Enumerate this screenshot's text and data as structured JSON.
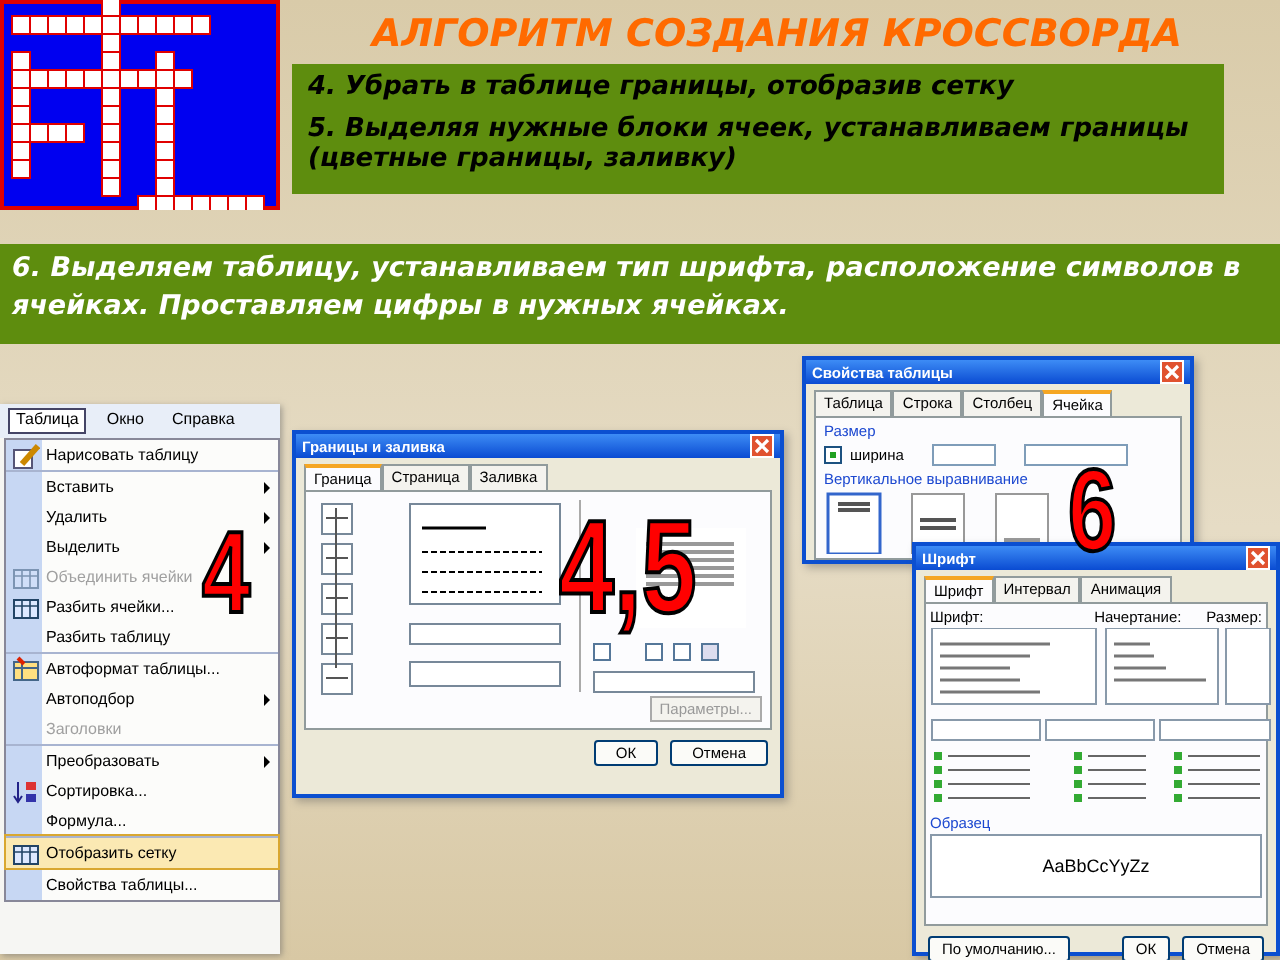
{
  "title": "АЛГОРИТМ СОЗДАНИЯ КРОССВОРДА",
  "steps_box": {
    "steps": [
      "4. Убрать в таблице границы, отобразив сетку",
      "5. Выделяя нужные блоки ячеек, устанавливаем границы (цветные границы, заливку)"
    ]
  },
  "step_banner": {
    "text": "6. Выделяем таблицу, устанавливаем тип шрифта, расположение символов в ячейках. Проставляем цифры в нужных ячейках."
  },
  "table_menu": {
    "badge": "4",
    "menubar": [
      {
        "label": "Таблица",
        "selected": true
      },
      {
        "label": "Окно",
        "selected": false
      },
      {
        "label": "Справка",
        "selected": false
      }
    ],
    "items": [
      {
        "label": "Нарисовать таблицу",
        "kind": "pencil",
        "submenu": false,
        "disabled": false,
        "selected": false,
        "divider_above": false
      },
      {
        "label": "Вставить",
        "kind": "plain",
        "submenu": true,
        "disabled": false,
        "selected": false,
        "divider_above": true
      },
      {
        "label": "Удалить",
        "kind": "plain",
        "submenu": true,
        "disabled": false,
        "selected": false,
        "divider_above": false
      },
      {
        "label": "Выделить",
        "kind": "plain",
        "submenu": true,
        "disabled": false,
        "selected": false,
        "divider_above": false
      },
      {
        "label": "Объединить ячейки",
        "kind": "merge",
        "submenu": false,
        "disabled": true,
        "selected": false,
        "divider_above": false
      },
      {
        "label": "Разбить ячейки...",
        "kind": "split",
        "submenu": false,
        "disabled": false,
        "selected": false,
        "divider_above": false
      },
      {
        "label": "Разбить таблицу",
        "kind": "plain",
        "submenu": false,
        "disabled": false,
        "selected": false,
        "divider_above": false
      },
      {
        "label": "Автоформат таблицы...",
        "kind": "autoformat",
        "submenu": false,
        "disabled": false,
        "selected": false,
        "divider_above": true
      },
      {
        "label": "Автоподбор",
        "kind": "plain",
        "submenu": true,
        "disabled": false,
        "selected": false,
        "divider_above": false
      },
      {
        "label": "Заголовки",
        "kind": "plain",
        "submenu": false,
        "disabled": true,
        "selected": false,
        "divider_above": false
      },
      {
        "label": "Преобразовать",
        "kind": "plain",
        "submenu": true,
        "disabled": false,
        "selected": false,
        "divider_above": true
      },
      {
        "label": "Сортировка...",
        "kind": "sort",
        "submenu": false,
        "disabled": false,
        "selected": false,
        "divider_above": false
      },
      {
        "label": "Формула...",
        "kind": "plain",
        "submenu": false,
        "disabled": false,
        "selected": false,
        "divider_above": false
      },
      {
        "label": "Отобразить сетку",
        "kind": "grid",
        "submenu": false,
        "disabled": false,
        "selected": true,
        "divider_above": true
      },
      {
        "label": "Свойства таблицы...",
        "kind": "plain",
        "submenu": false,
        "disabled": false,
        "selected": false,
        "divider_above": true
      }
    ]
  },
  "borders_dialog": {
    "title": "Границы и заливка",
    "badge": "4,5",
    "tabs": [
      {
        "label": "Граница",
        "selected": true
      },
      {
        "label": "Страница",
        "selected": false
      },
      {
        "label": "Заливка",
        "selected": false
      }
    ],
    "options_button": "Параметры...",
    "buttons": [
      "ОК",
      "Отмена"
    ]
  },
  "table_props_dialog": {
    "title": "Свойства таблицы",
    "badge": "6",
    "tabs": [
      {
        "label": "Таблица",
        "selected": false
      },
      {
        "label": "Строка",
        "selected": false
      },
      {
        "label": "Столбец",
        "selected": false
      },
      {
        "label": "Ячейка",
        "selected": true
      }
    ],
    "size_label": "Размер",
    "width_checkbox": {
      "label": "ширина",
      "checked": true
    },
    "align_label": "Вертикальное выравнивание"
  },
  "font_dialog": {
    "title": "Шрифт",
    "tabs": [
      {
        "label": "Шрифт",
        "selected": true
      },
      {
        "label": "Интервал",
        "selected": false
      },
      {
        "label": "Анимация",
        "selected": false
      }
    ],
    "columns": [
      "Шрифт:",
      "Начертание:",
      "Размер:"
    ],
    "sample_label": "Образец",
    "sample": "AaBbCcYyZz",
    "default_button": "По умолчанию...",
    "buttons": [
      "ОК",
      "Отмена"
    ]
  }
}
